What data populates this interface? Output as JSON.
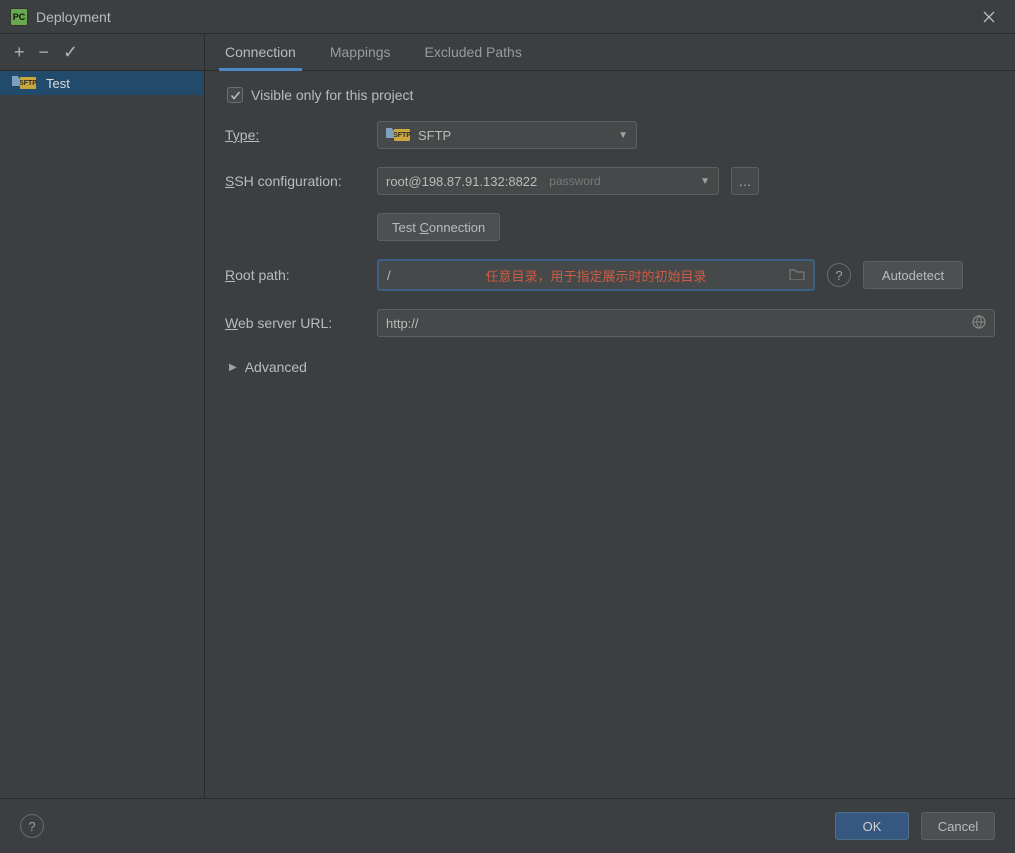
{
  "window": {
    "title": "Deployment"
  },
  "sidebar": {
    "toolbar": {
      "add": "+",
      "remove": "−",
      "accept": "✓"
    },
    "items": [
      {
        "label": "Test"
      }
    ]
  },
  "tabs": [
    {
      "label": "Connection",
      "active": true
    },
    {
      "label": "Mappings"
    },
    {
      "label": "Excluded Paths"
    }
  ],
  "form": {
    "visible_only_label": "Visible only for this project",
    "visible_only_checked": true,
    "type_label": "Type:",
    "type_value": "SFTP",
    "ssh_label_pre": "S",
    "ssh_label_rest": "SH configuration:",
    "ssh_value": "root@198.87.91.132:8822",
    "ssh_hint": "password",
    "test_connection_label": "Test Connection",
    "root_label_pre": "R",
    "root_label_rest": "oot path:",
    "root_value": "/",
    "root_overlay_note": "任意目录，用于指定展示时的初始目录",
    "autodetect_label": "Autodetect",
    "url_label_pre": "W",
    "url_label_rest": "eb server URL:",
    "url_value": "http://",
    "advanced_label": "Advanced"
  },
  "footer": {
    "ok": "OK",
    "cancel": "Cancel"
  }
}
